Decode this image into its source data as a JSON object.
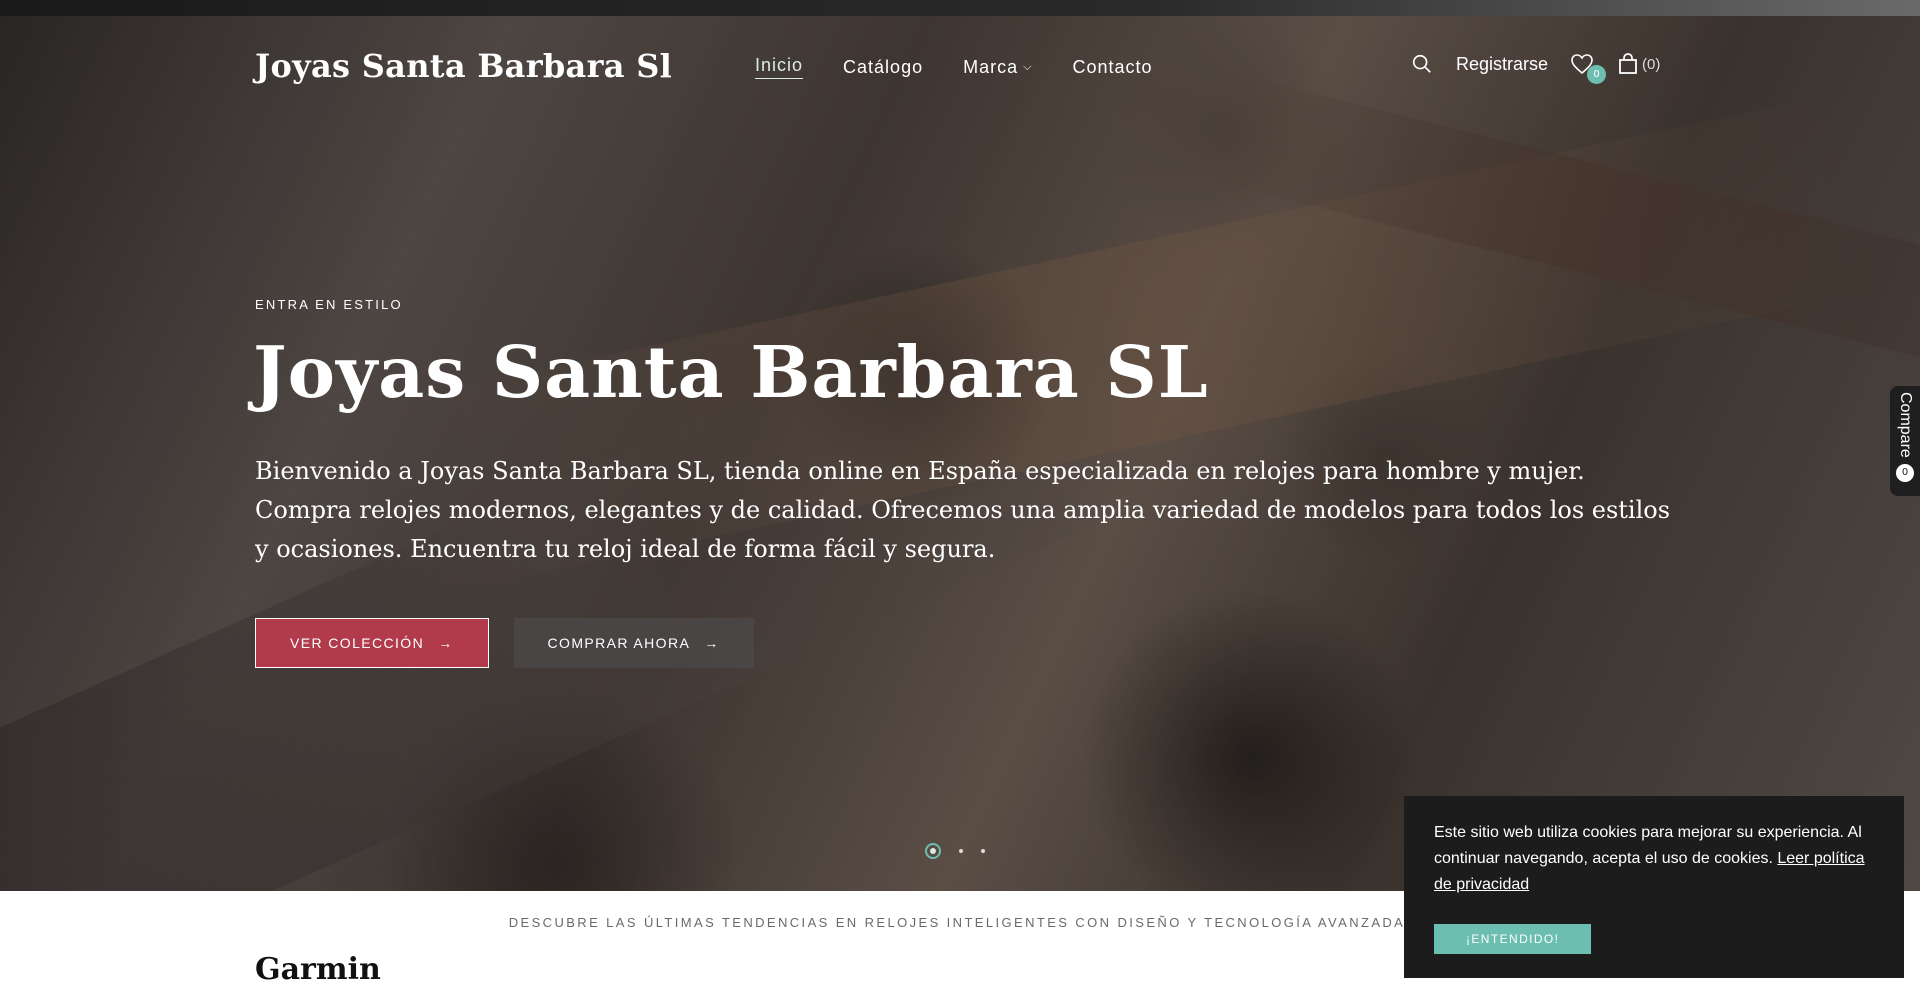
{
  "header": {
    "logo": "Joyas Santa Barbara Sl",
    "nav": [
      {
        "label": "Inicio"
      },
      {
        "label": "Catálogo"
      },
      {
        "label": "Marca"
      },
      {
        "label": "Contacto"
      }
    ],
    "register_label": "Registrarse",
    "wishlist_count": "0",
    "cart_count": "(0)"
  },
  "hero": {
    "eyebrow": "ENTRA EN ESTILO",
    "title": "Joyas Santa Barbara SL",
    "description": "Bienvenido a Joyas Santa Barbara SL, tienda online en España especializada en relojes para hombre y mujer. Compra relojes modernos, elegantes y de calidad. Ofrecemos una amplia variedad de modelos para todos los estilos y ocasiones. Encuentra tu reloj ideal de forma fácil y segura.",
    "primary_button": "VER COLECCIÓN",
    "secondary_button": "COMPRAR AHORA",
    "arrow": "→",
    "active_slide": 1,
    "slide_count": 3
  },
  "compare": {
    "label": "Compare",
    "count": "0"
  },
  "section": {
    "tagline": "DESCUBRE LAS ÚLTIMAS TENDENCIAS EN RELOJES INTELIGENTES CON DISEÑO Y TECNOLOGÍA AVANZADA.",
    "title": "Garmin"
  },
  "cookie": {
    "text": "Este sitio web utiliza cookies para mejorar su experiencia. Al continuar navegando, acepta el uso de cookies.",
    "link": "Leer política de privacidad",
    "button": "¡ENTENDIDO!"
  },
  "colors": {
    "accent": "#6cbfb0",
    "primary_button": "#b13a4b",
    "cookie_bg": "#1c1c1c"
  },
  "icons": [
    "search-icon",
    "heart-icon",
    "shopping-bag-icon",
    "chevron-down-icon",
    "arrow-right-icon"
  ]
}
